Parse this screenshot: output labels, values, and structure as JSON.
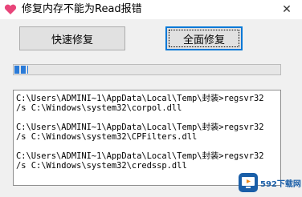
{
  "window": {
    "title": "修复内存不能为Read报错",
    "close_glyph": "✕"
  },
  "buttons": {
    "quick_repair": "快速修复",
    "full_repair": "全面修复"
  },
  "progress": {
    "value_fraction": 0.05
  },
  "log": {
    "lines": [
      "C:\\Users\\ADMINI~1\\AppData\\Local\\Temp\\封装>regsvr32",
      "/s C:\\Windows\\system32\\corpol.dll",
      "C:\\Users\\ADMINI~1\\AppData\\Local\\Temp\\封装>regsvr32",
      "/s C:\\Windows\\system32\\CPFilters.dll",
      "C:\\Users\\ADMINI~1\\AppData\\Local\\Temp\\封装>regsvr32",
      "/s C:\\Windows\\system32\\credssp.dll"
    ]
  },
  "watermark": {
    "text": "592下载网"
  },
  "colors": {
    "progress": "#2b7bd8",
    "app_icon": "#e8457a",
    "focus_border": "#0078d7"
  },
  "icons": {
    "app": "app-heart-icon",
    "close": "close-icon",
    "watermark": "watermark-logo-icon"
  }
}
